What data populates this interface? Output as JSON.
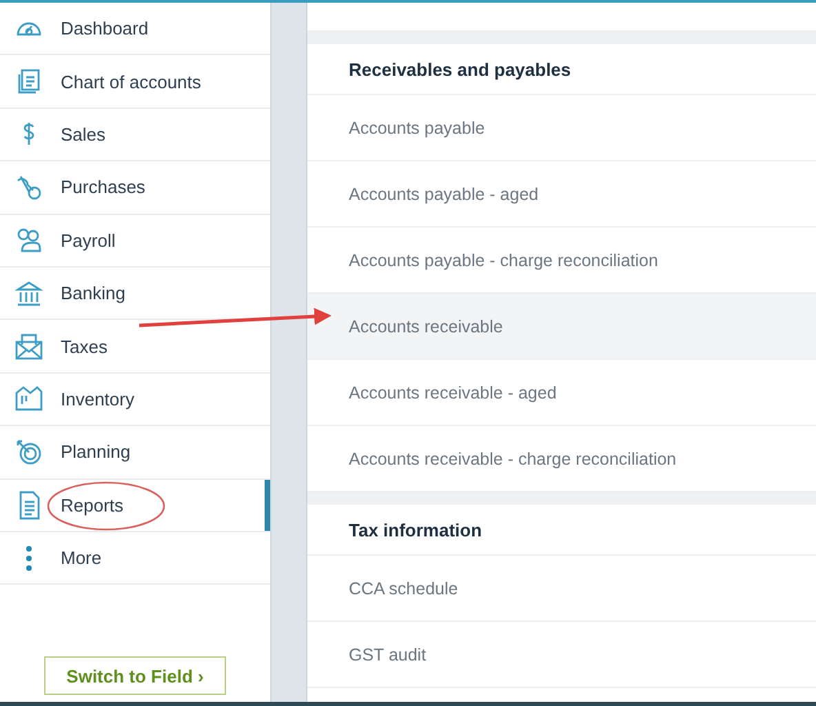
{
  "sidebar": {
    "items": [
      {
        "label": "Dashboard",
        "selected": false
      },
      {
        "label": "Chart of accounts",
        "selected": false
      },
      {
        "label": "Sales",
        "selected": false
      },
      {
        "label": "Purchases",
        "selected": false
      },
      {
        "label": "Payroll",
        "selected": false
      },
      {
        "label": "Banking",
        "selected": false
      },
      {
        "label": "Taxes",
        "selected": false
      },
      {
        "label": "Inventory",
        "selected": false
      },
      {
        "label": "Planning",
        "selected": false
      },
      {
        "label": "Reports",
        "selected": true
      },
      {
        "label": "More",
        "selected": false
      }
    ],
    "button": "Switch to Field ›"
  },
  "sections": [
    {
      "title": "Receivables and payables",
      "reports": [
        {
          "label": "Accounts payable",
          "selected": false
        },
        {
          "label": "Accounts payable - aged",
          "selected": false
        },
        {
          "label": "Accounts payable - charge reconciliation",
          "selected": false
        },
        {
          "label": "Accounts receivable",
          "selected": true
        },
        {
          "label": "Accounts receivable - aged",
          "selected": false
        },
        {
          "label": "Accounts receivable - charge reconciliation",
          "selected": false
        }
      ]
    },
    {
      "title": "Tax information",
      "reports": [
        {
          "label": "CCA schedule",
          "selected": false
        },
        {
          "label": "GST audit",
          "selected": false
        }
      ]
    }
  ]
}
